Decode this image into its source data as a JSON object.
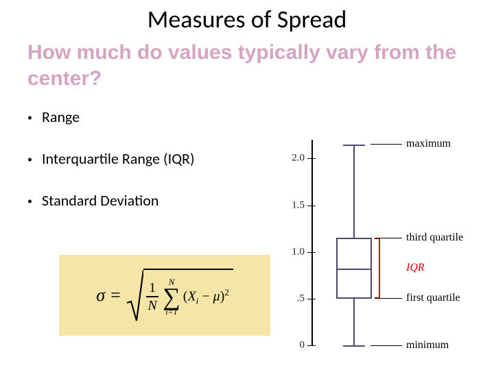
{
  "title": "Measures of Spread",
  "subtitle": "How much do values typically vary from the center?",
  "bullets": [
    "Range",
    "Interquartile Range (IQR)",
    "Standard Deviation"
  ],
  "formula": {
    "lhs": "σ =",
    "frac_num": "1",
    "frac_den": "N",
    "sum_top": "N",
    "sum_bottom": "i=1",
    "inside_open": "(",
    "var_x": "X",
    "sub_i": "i",
    "minus": " − ",
    "mu": "μ",
    "inside_close": ")",
    "sq": "2"
  },
  "chart_data": {
    "type": "boxplot",
    "title": "",
    "ylabel": "",
    "ylim": [
      0,
      2.2
    ],
    "ticks": [
      0,
      0.5,
      1.0,
      1.5,
      2.0
    ],
    "tick_labels": [
      "0",
      ".5",
      "1.0",
      "1.5",
      "2.0"
    ],
    "values": {
      "minimum": 0.0,
      "first_quartile": 0.5,
      "median": 0.82,
      "third_quartile": 1.15,
      "maximum": 2.15
    },
    "annotations": {
      "maximum": "maximum",
      "third_quartile": "third quartile",
      "iqr": "IQR",
      "first_quartile": "first quartile",
      "minimum": "minimum"
    }
  }
}
